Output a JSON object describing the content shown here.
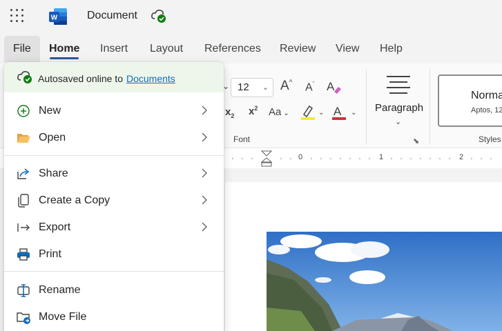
{
  "titlebar": {
    "document_title": "Document",
    "app_icon": "word-icon",
    "cloud_icon": "cloud-saved-icon"
  },
  "tabs": [
    {
      "label": "File"
    },
    {
      "label": "Home"
    },
    {
      "label": "Insert"
    },
    {
      "label": "Layout"
    },
    {
      "label": "References"
    },
    {
      "label": "Review"
    },
    {
      "label": "View"
    },
    {
      "label": "Help"
    }
  ],
  "ribbon": {
    "font_size": "12",
    "font_group_label": "Font",
    "paragraph_label": "Paragraph",
    "style_name": "Norma",
    "style_font": "Aptos, 12",
    "styles_group_label": "Styles",
    "grow_font": "A",
    "shrink_font": "A",
    "subscript": "x",
    "superscript": "x",
    "change_case": "Aa",
    "font_color": "A"
  },
  "ruler": {
    "numbers": [
      "0",
      "1",
      "2"
    ]
  },
  "file_menu": {
    "autosave_text": "Autosaved online to",
    "autosave_link": "Documents",
    "items": [
      {
        "label": "New"
      },
      {
        "label": "Open"
      },
      {
        "label": "Share"
      },
      {
        "label": "Create a Copy"
      },
      {
        "label": "Export"
      },
      {
        "label": "Print"
      },
      {
        "label": "Rename"
      },
      {
        "label": "Move File"
      }
    ]
  },
  "colors": {
    "accent": "#2b579a",
    "link": "#0f6cbd",
    "autosave_bg": "#eef6ec",
    "highlight": "#f7e93a",
    "font_color_bar": "#d13438"
  }
}
